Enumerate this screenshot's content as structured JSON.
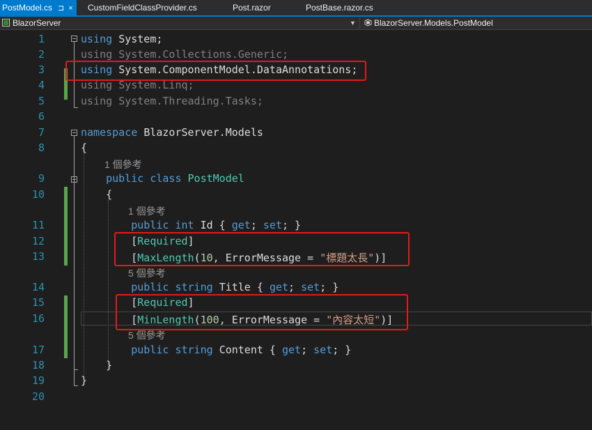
{
  "tabs": [
    {
      "label": "PostModel.cs",
      "active": true,
      "pin": "⊐",
      "close": "×"
    },
    {
      "label": "CustomFieldClassProvider.cs",
      "active": false
    },
    {
      "label": "Post.razor",
      "active": false
    },
    {
      "label": "PostBase.razor.cs",
      "active": false
    }
  ],
  "nav": {
    "project": "BlazorServer",
    "member": "BlazorServer.Models.PostModel"
  },
  "icons": {
    "project": "csharp-project-icon",
    "member": "class-icon",
    "pin": "pin-icon",
    "close": "close-icon",
    "dropdown": "chevron-down-icon"
  },
  "colors": {
    "accent": "#007acc",
    "keyword": "#569cd6",
    "type": "#4ec9b0",
    "string": "#d69d85",
    "line_number": "#2b91af",
    "highlight_box": "#e21b1b",
    "changed_line": "#57a64a"
  },
  "editor": {
    "lines": [
      {
        "n": "1",
        "p": [
          [
            "kw",
            "using"
          ],
          [
            "",
            "System;"
          ]
        ]
      },
      {
        "n": "2",
        "p": [
          [
            "dim",
            "using"
          ],
          [
            "dim",
            "System.Collections.Generic;"
          ]
        ]
      },
      {
        "n": "3",
        "p": [
          [
            "kw",
            "using"
          ],
          [
            "",
            "System.ComponentModel.DataAnnotations;"
          ]
        ]
      },
      {
        "n": "4",
        "p": [
          [
            "dim",
            "using"
          ],
          [
            "dim",
            "System.Linq;"
          ]
        ]
      },
      {
        "n": "5",
        "p": [
          [
            "dim",
            "using"
          ],
          [
            "dim",
            "System.Threading.Tasks;"
          ]
        ]
      },
      {
        "n": "6",
        "p": []
      },
      {
        "n": "7",
        "p": [
          [
            "kw",
            "namespace"
          ],
          [
            "",
            "BlazorServer.Models"
          ]
        ]
      },
      {
        "n": "8",
        "p": [
          [
            "",
            "{"
          ]
        ]
      },
      {
        "n": "",
        "lens": "1 個參考"
      },
      {
        "n": "9",
        "p": [
          [
            "",
            "    "
          ],
          [
            "kw",
            "public"
          ],
          [
            "kw",
            "class"
          ],
          [
            "ty",
            "PostModel"
          ]
        ]
      },
      {
        "n": "10",
        "p": [
          [
            "",
            "    {"
          ]
        ]
      },
      {
        "n": "",
        "lens": "1 個參考"
      },
      {
        "n": "11",
        "p": [
          [
            "",
            "        "
          ],
          [
            "kw",
            "public"
          ],
          [
            "kw",
            "int"
          ],
          [
            "",
            "Id { "
          ],
          [
            "kw",
            "get"
          ],
          [
            "",
            "; "
          ],
          [
            "kw",
            "set"
          ],
          [
            "",
            "; }"
          ]
        ]
      },
      {
        "n": "12",
        "p": [
          [
            "",
            "        ["
          ],
          [
            "ty",
            "Required"
          ],
          [
            "",
            "]"
          ]
        ]
      },
      {
        "n": "13",
        "p": [
          [
            "",
            "        ["
          ],
          [
            "ty",
            "MaxLength"
          ],
          [
            "",
            "("
          ],
          [
            "num",
            "10"
          ],
          [
            "",
            ", ErrorMessage = "
          ],
          [
            "str",
            "\"標題太長\""
          ],
          [
            "",
            ")]"
          ]
        ]
      },
      {
        "n": "",
        "lens": "5 個參考"
      },
      {
        "n": "14",
        "p": [
          [
            "",
            "        "
          ],
          [
            "kw",
            "public"
          ],
          [
            "kw",
            "string"
          ],
          [
            "",
            "Title { "
          ],
          [
            "kw",
            "get"
          ],
          [
            "",
            "; "
          ],
          [
            "kw",
            "set"
          ],
          [
            "",
            "; }"
          ]
        ]
      },
      {
        "n": "15",
        "p": [
          [
            "",
            "        ["
          ],
          [
            "ty",
            "Required"
          ],
          [
            "",
            "]"
          ]
        ]
      },
      {
        "n": "16",
        "p": [
          [
            "",
            "        ["
          ],
          [
            "ty",
            "MinLength"
          ],
          [
            "",
            "("
          ],
          [
            "num",
            "100"
          ],
          [
            "",
            ", ErrorMessage = "
          ],
          [
            "str",
            "\"內容太短\""
          ],
          [
            "",
            ")]"
          ]
        ]
      },
      {
        "n": "",
        "lens": "5 個參考"
      },
      {
        "n": "17",
        "p": [
          [
            "",
            "        "
          ],
          [
            "kw",
            "public"
          ],
          [
            "kw",
            "string"
          ],
          [
            "",
            "Content { "
          ],
          [
            "kw",
            "get"
          ],
          [
            "",
            "; "
          ],
          [
            "kw",
            "set"
          ],
          [
            "",
            "; }"
          ]
        ]
      },
      {
        "n": "18",
        "p": [
          [
            "",
            "    }"
          ]
        ]
      },
      {
        "n": "19",
        "p": [
          [
            "",
            "}"
          ]
        ]
      },
      {
        "n": "20",
        "p": []
      }
    ]
  }
}
